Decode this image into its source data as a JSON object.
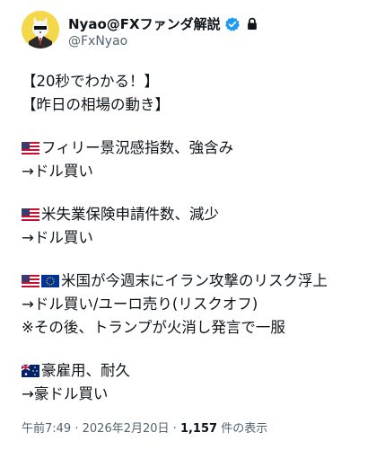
{
  "header": {
    "display_name": "Nyao@FXファンダ解説",
    "handle": "@FxNyao",
    "avatar_icon": "cat-in-suit-avatar",
    "verified_icon": "verified-badge-icon",
    "lock_icon": "lock-icon",
    "verified_color": "#1d9bf0"
  },
  "post": {
    "line1": "【20秒でわかる！】",
    "line2": "【昨日の相場の動き】",
    "item1_text": "フィリー景況感指数、強含み",
    "item1_result": "→ドル買い",
    "item2_text": "米失業保険申請件数、減少",
    "item2_result": "→ドル買い",
    "item3_text": "米国が今週末にイラン攻撃のリスク浮上",
    "item3_result": "→ドル買い/ユーロ売り(リスクオフ)",
    "item3_note": "※その後、トランプが火消し発言で一服",
    "item4_text": "豪雇用、耐久",
    "item4_result": "→豪ドル買い",
    "flags": [
      "us-flag-icon",
      "eu-flag-icon",
      "au-flag-icon"
    ]
  },
  "meta": {
    "time": "午前7:49",
    "separator": "·",
    "date": "2026年2月20日",
    "views_count": "1,157",
    "views_label": "件の表示"
  }
}
